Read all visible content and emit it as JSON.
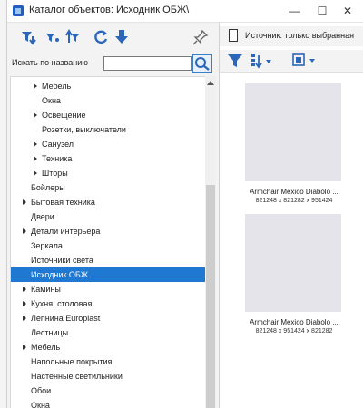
{
  "window": {
    "title": "Каталог объектов: Исходник ОБЖ\\",
    "minimize_glyph": "—",
    "maximize_glyph": "☐",
    "close_glyph": "✕"
  },
  "left_toolbar": {
    "icons": [
      "filter-down-icon",
      "filter-small-icon",
      "filter-up-icon",
      "refresh-icon",
      "download-arrow-icon",
      "pin-icon"
    ]
  },
  "search": {
    "label": "Искать по названию",
    "value": "",
    "button_icon": "search-icon"
  },
  "tree": {
    "items": [
      {
        "label": "Мебель",
        "indent": 1,
        "expandable": true,
        "selected": false
      },
      {
        "label": "Окна",
        "indent": 1,
        "expandable": false,
        "selected": false
      },
      {
        "label": "Освещение",
        "indent": 1,
        "expandable": true,
        "selected": false
      },
      {
        "label": "Розетки, выключатели",
        "indent": 1,
        "expandable": false,
        "selected": false
      },
      {
        "label": "Санузел",
        "indent": 1,
        "expandable": true,
        "selected": false
      },
      {
        "label": "Техника",
        "indent": 1,
        "expandable": true,
        "selected": false
      },
      {
        "label": "Шторы",
        "indent": 1,
        "expandable": true,
        "selected": false
      },
      {
        "label": "Бойлеры",
        "indent": 0,
        "expandable": false,
        "selected": false
      },
      {
        "label": "Бытовая техника",
        "indent": 0,
        "expandable": true,
        "selected": false
      },
      {
        "label": "Двери",
        "indent": 0,
        "expandable": false,
        "selected": false
      },
      {
        "label": "Детали интерьера",
        "indent": 0,
        "expandable": true,
        "selected": false
      },
      {
        "label": "Зеркала",
        "indent": 0,
        "expandable": false,
        "selected": false
      },
      {
        "label": "Источники света",
        "indent": 0,
        "expandable": false,
        "selected": false
      },
      {
        "label": "Исходник ОБЖ",
        "indent": 0,
        "expandable": false,
        "selected": true
      },
      {
        "label": "Камины",
        "indent": 0,
        "expandable": true,
        "selected": false
      },
      {
        "label": "Кухня, столовая",
        "indent": 0,
        "expandable": true,
        "selected": false
      },
      {
        "label": "Лепнина Europlast",
        "indent": 0,
        "expandable": true,
        "selected": false
      },
      {
        "label": "Лестницы",
        "indent": 0,
        "expandable": false,
        "selected": false
      },
      {
        "label": "Мебель",
        "indent": 0,
        "expandable": true,
        "selected": false
      },
      {
        "label": "Напольные покрытия",
        "indent": 0,
        "expandable": false,
        "selected": false
      },
      {
        "label": "Настенные светильники",
        "indent": 0,
        "expandable": false,
        "selected": false
      },
      {
        "label": "Обои",
        "indent": 0,
        "expandable": false,
        "selected": false
      },
      {
        "label": "Окна",
        "indent": 0,
        "expandable": false,
        "selected": false
      }
    ]
  },
  "right_panel": {
    "source_label": "Источник: только выбранная",
    "toolbar_icons": [
      "filter-icon",
      "sort-icon",
      "view-mode-icon"
    ]
  },
  "objects": [
    {
      "name": "Armchair Mexico Diabolo ...",
      "dims": "821248 x 821282 x 951424"
    },
    {
      "name": "Armchair Mexico Diabolo ...",
      "dims": "821248 x 951424 x 821282"
    }
  ],
  "colors": {
    "accent": "#1f78d1",
    "filter_blue": "#2b66b8",
    "thumb_bg": "#e4e4ea"
  }
}
